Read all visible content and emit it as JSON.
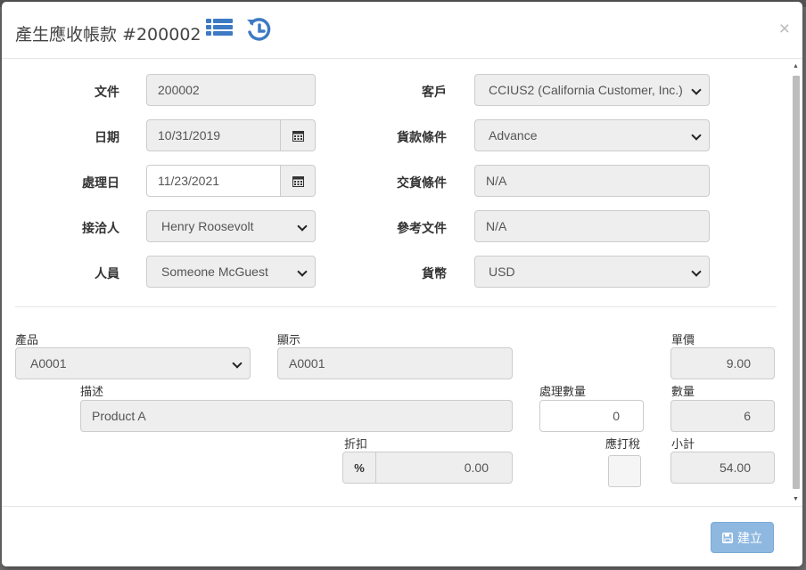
{
  "background": {
    "top_items": [
      "…",
      "…",
      "…"
    ],
    "top_user": "Someone M…",
    "bottom_items": [
      "…",
      "…",
      "…",
      "…",
      "…"
    ]
  },
  "modal": {
    "title": "產生應收帳款 #200002",
    "icons": [
      "list-icon",
      "history-icon"
    ],
    "close_label": "×"
  },
  "header_form": {
    "document": {
      "label": "文件",
      "value": "200002"
    },
    "date": {
      "label": "日期",
      "value": "10/31/2019"
    },
    "process_date": {
      "label": "處理日",
      "value": "11/23/2021"
    },
    "contact": {
      "label": "接洽人",
      "value": "Henry Roosevolt"
    },
    "staff": {
      "label": "人員",
      "value": "Someone McGuest"
    },
    "customer": {
      "label": "客戶",
      "value": "CCIUS2 (California Customer, Inc.)"
    },
    "payment_terms": {
      "label": "貨款條件",
      "value": "Advance"
    },
    "delivery_terms": {
      "label": "交貨條件",
      "value": "N/A"
    },
    "reference": {
      "label": "參考文件",
      "value": "N/A"
    },
    "currency": {
      "label": "貨幣",
      "value": "USD"
    }
  },
  "line_item": {
    "product": {
      "label": "產品",
      "value": "A0001"
    },
    "display": {
      "label": "顯示",
      "value": "A0001"
    },
    "unit_price": {
      "label": "單價",
      "value": "9.00"
    },
    "description": {
      "label": "描述",
      "value": "Product A"
    },
    "process_qty": {
      "label": "處理數量",
      "value": "0"
    },
    "quantity": {
      "label": "數量",
      "value": "6"
    },
    "discount": {
      "label": "折扣",
      "addon": "%",
      "value": "0.00"
    },
    "taxable": {
      "label": "應打稅",
      "checked": false
    },
    "subtotal": {
      "label": "小計",
      "value": "54.00"
    }
  },
  "footer": {
    "create_label": "建立"
  },
  "colors": {
    "accent": "#3d7ac4",
    "button": "#8fb8e0"
  }
}
